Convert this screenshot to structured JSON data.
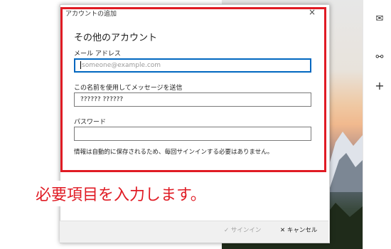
{
  "dialog": {
    "title": "アカウントの追加",
    "close_glyph": "×",
    "heading": "その他のアカウント",
    "email_label": "メール アドレス",
    "email_placeholder": "someone@example.com",
    "name_label": "この名前を使用してメッセージを送信",
    "name_value": "?????? ??????",
    "password_label": "パスワード",
    "password_value": "",
    "note": "情報は自動的に保存されるため、毎回サインインする必要はありません。",
    "signin_label": "サインイン",
    "signin_icon": "check-icon",
    "cancel_label": "キャンセル",
    "cancel_icon": "close-icon"
  },
  "rail": {
    "icons": [
      "mail-icon",
      "people-icon",
      "add-icon"
    ]
  },
  "annotation": {
    "callout_text": "必要項目を入力します。",
    "highlight_color": "#e01b24"
  },
  "colors": {
    "accent": "#0067c0",
    "highlight": "#e01b24"
  }
}
